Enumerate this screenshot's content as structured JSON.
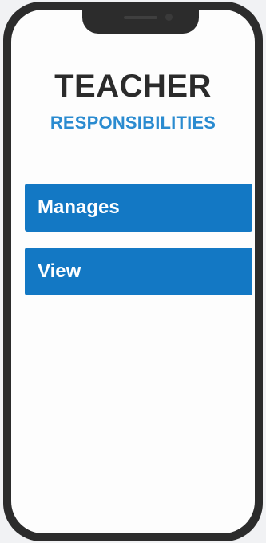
{
  "header": {
    "title": "TEACHER",
    "subtitle": "RESPONSIBILITIES"
  },
  "menu": {
    "items": [
      {
        "label": "Manages"
      },
      {
        "label": "View"
      }
    ]
  },
  "colors": {
    "accent": "#2a8bd0",
    "button": "#1378c4",
    "title": "#2b2b2b",
    "phone_frame": "#2c2c2c"
  }
}
